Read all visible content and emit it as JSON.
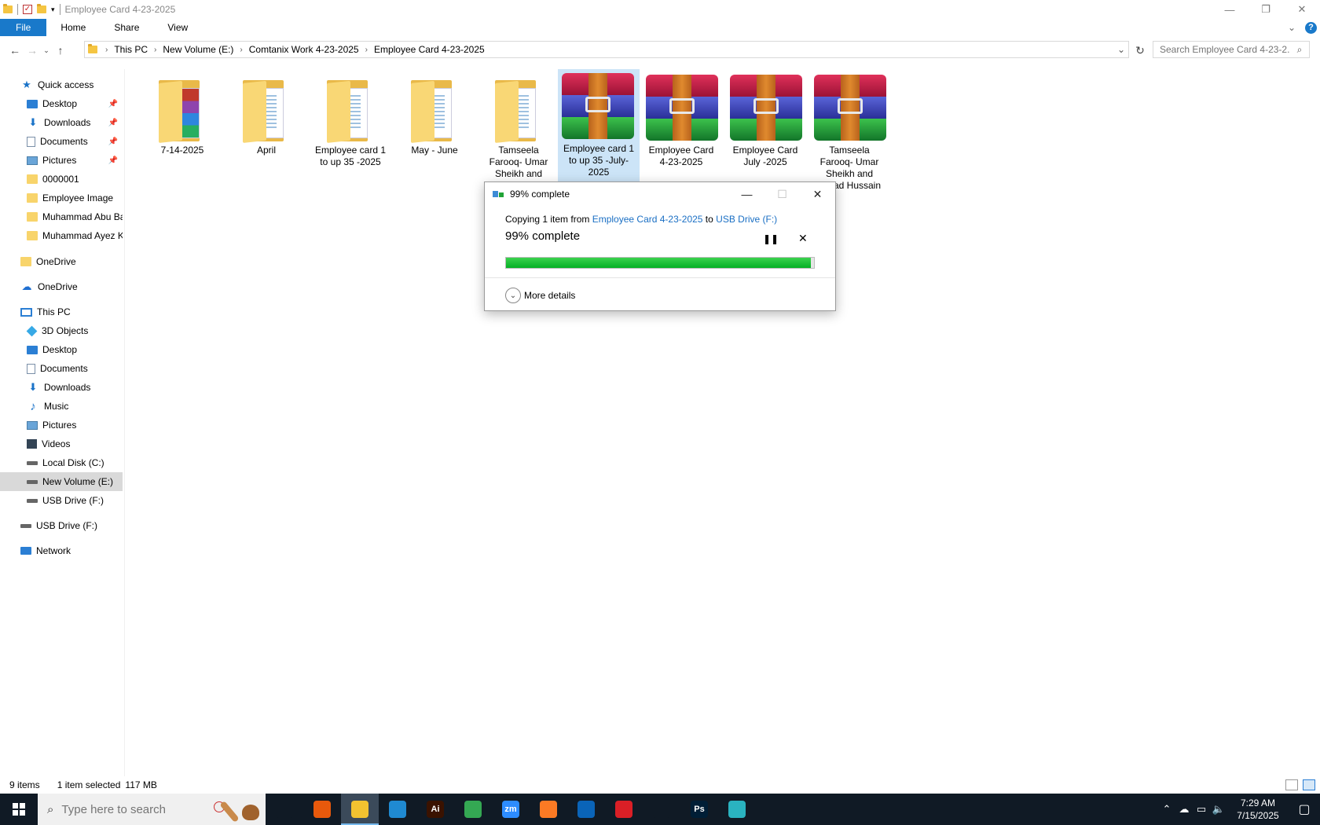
{
  "window": {
    "title": "Employee Card 4-23-2025"
  },
  "ribbon": {
    "tabs": [
      "File",
      "Home",
      "Share",
      "View"
    ]
  },
  "address": {
    "crumbs": [
      "This PC",
      "New Volume (E:)",
      "Comtanix Work 4-23-2025",
      "Employee Card 4-23-2025"
    ]
  },
  "search": {
    "placeholder": "Search Employee Card 4-23-2..."
  },
  "sidebar": {
    "quick_access": "Quick access",
    "quick_items": [
      {
        "label": "Desktop",
        "icon": "desktop-icon",
        "pinned": true
      },
      {
        "label": "Downloads",
        "icon": "downloads-icon",
        "pinned": true
      },
      {
        "label": "Documents",
        "icon": "documents-icon",
        "pinned": true
      },
      {
        "label": "Pictures",
        "icon": "pictures-icon",
        "pinned": true
      },
      {
        "label": "0000001",
        "icon": "folder-icon",
        "pinned": false
      },
      {
        "label": "Employee Image",
        "icon": "folder-icon",
        "pinned": false
      },
      {
        "label": "Muhammad Abu Ba",
        "icon": "folder-icon",
        "pinned": false
      },
      {
        "label": "Muhammad Ayez K",
        "icon": "folder-icon",
        "pinned": false
      }
    ],
    "onedrive_folder": "OneDrive",
    "onedrive_cloud": "OneDrive",
    "this_pc": "This PC",
    "pc_items": [
      {
        "label": "3D Objects",
        "icon": "3d-objects-icon"
      },
      {
        "label": "Desktop",
        "icon": "desktop-icon"
      },
      {
        "label": "Documents",
        "icon": "documents-icon"
      },
      {
        "label": "Downloads",
        "icon": "downloads-icon"
      },
      {
        "label": "Music",
        "icon": "music-icon"
      },
      {
        "label": "Pictures",
        "icon": "pictures-icon"
      },
      {
        "label": "Videos",
        "icon": "videos-icon"
      },
      {
        "label": "Local Disk (C:)",
        "icon": "local-disk-icon"
      },
      {
        "label": "New Volume (E:)",
        "icon": "drive-icon",
        "selected": true
      },
      {
        "label": "USB Drive (F:)",
        "icon": "usb-drive-icon"
      }
    ],
    "usb_drive": "USB Drive (F:)",
    "network": "Network"
  },
  "files": [
    {
      "name": "7-14-2025",
      "type": "folder",
      "variant": "colorful"
    },
    {
      "name": "April",
      "type": "folder",
      "variant": "plain"
    },
    {
      "name": "Employee card 1 to up 35 -2025",
      "type": "folder",
      "variant": "plain"
    },
    {
      "name": "May - June",
      "type": "folder",
      "variant": "plain"
    },
    {
      "name": "Tamseela Farooq- Umar Sheikh and Sajjad",
      "type": "folder",
      "variant": "plain"
    },
    {
      "name": "Employee card 1 to up 35 -July-2025",
      "type": "rar",
      "selected": true
    },
    {
      "name": "Employee Card 4-23-2025",
      "type": "rar"
    },
    {
      "name": "Employee Card July -2025",
      "type": "rar"
    },
    {
      "name": "Tamseela Farooq- Umar Sheikh and Sajjad Hussain",
      "type": "rar"
    }
  ],
  "dialog": {
    "title": "99% complete",
    "copy_prefix": "Copying 1 item from ",
    "source": "Employee Card 4-23-2025",
    "copy_to": " to ",
    "destination": "USB Drive (F:)",
    "percent_label": "99% complete",
    "progress_percent": 99,
    "more_details": "More details"
  },
  "status": {
    "item_count": "9 items",
    "selection": "1 item selected",
    "size": "117 MB"
  },
  "taskbar": {
    "search_placeholder": "Type here to search",
    "time": "7:29 AM",
    "date": "7/15/2025",
    "apps": [
      {
        "name": "task-view-icon",
        "label": "",
        "color": "#101a25"
      },
      {
        "name": "firefox-icon",
        "label": "",
        "color": "#e8590c"
      },
      {
        "name": "file-explorer-icon",
        "label": "",
        "color": "#f2c230",
        "active": true
      },
      {
        "name": "vscode-icon",
        "label": "",
        "color": "#1f8ad2"
      },
      {
        "name": "illustrator-icon",
        "label": "Ai",
        "color": "#3a1200"
      },
      {
        "name": "chrome-icon",
        "label": "",
        "color": "#34a853"
      },
      {
        "name": "zoom-icon",
        "label": "zm",
        "color": "#2d8cff"
      },
      {
        "name": "xampp-icon",
        "label": "",
        "color": "#fb7a24"
      },
      {
        "name": "outlook-icon",
        "label": "",
        "color": "#0a64b8"
      },
      {
        "name": "creative-cloud-icon",
        "label": "",
        "color": "#da1f26"
      },
      {
        "name": "pen-tool-icon",
        "label": "",
        "color": "#101a25"
      },
      {
        "name": "photoshop-icon",
        "label": "Ps",
        "color": "#001e36"
      },
      {
        "name": "app-icon",
        "label": "",
        "color": "#2ab3c0"
      }
    ]
  }
}
